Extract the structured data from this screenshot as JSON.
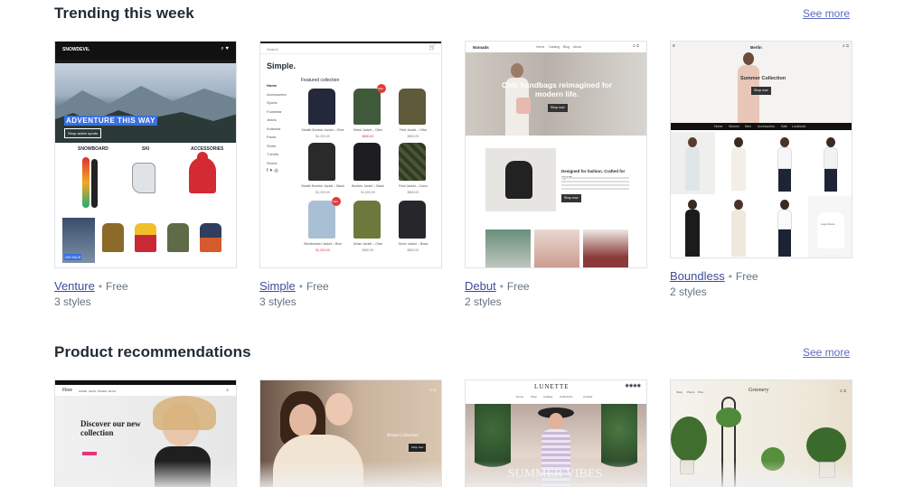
{
  "sections": [
    {
      "title": "Trending this week",
      "see_more": "See more",
      "themes": [
        {
          "name": "Venture",
          "price": "Free",
          "styles": "3 styles",
          "preview": {
            "logo": "SNOWDEVIL",
            "hero": "ADVENTURE THIS WAY",
            "hero_cta": "Shop action sports",
            "cats": [
              "SNOWBOARD",
              "SKI",
              "ACCESSORIES"
            ],
            "badge": "ON SALE"
          }
        },
        {
          "name": "Simple",
          "price": "Free",
          "styles": "3 styles",
          "preview": {
            "logo": "Simple.",
            "heading": "Featured collection",
            "search": "Search",
            "nav": [
              "Home",
              "Accessories",
              "Sports",
              "Footwear",
              "Jeans",
              "Knitwear",
              "Pants",
              "Shirts",
              "T-shirts",
              "Shorts"
            ],
            "products": [
              "Stealth Bomber Jacket – Olive",
              "Rebel Jacket – Olive",
              "Field Jacket – Olive",
              "Stealth Bomber Jacket – Black",
              "Bomber Jacket – Black",
              "Field Jacket – Camo",
              "Windbreaker Jacket – Blue",
              "Urban Jacket – Olive",
              "Storm Jacket – Black"
            ],
            "prices": [
              "$1,200.00",
              "$800.00",
              "$800.00",
              "$1,200.00",
              "$1,000.00",
              "$800.00",
              "$1,200.00",
              "$800.00",
              "$800.00"
            ],
            "sale": "Sale"
          }
        },
        {
          "name": "Debut",
          "price": "Free",
          "styles": "2 styles",
          "preview": {
            "logo": "Nomads",
            "nav": [
              "Home",
              "Catalog",
              "Blog",
              "About"
            ],
            "hero": "Chic handbags reimagined for modern life.",
            "hero_cta": "Shop now",
            "feature": "Designed for fashion. Crafted for sport.",
            "feature_cta": "Shop now"
          }
        },
        {
          "name": "Boundless",
          "price": "Free",
          "styles": "2 styles",
          "preview": {
            "logo": "Berlin",
            "hero": "Summer Collection",
            "hero_cta": "Shop now",
            "nav": [
              "Home",
              "Women",
              "Men",
              "Accessories",
              "Sale",
              "Lookbook"
            ],
            "tile_label": "Logo Dress"
          }
        }
      ]
    },
    {
      "title": "Product recommendations",
      "see_more": "See more",
      "themes": [
        {
          "preview": {
            "logo": "Flow",
            "nav": [
              "HOME",
              "SHOP",
              "PAGES",
              "BLOG"
            ],
            "hero": "Discover our new collection"
          }
        },
        {
          "preview": {
            "hero": "Bridal Collection",
            "cta": "Shop now"
          }
        },
        {
          "preview": {
            "logo": "LUNETTE",
            "tagline": "SUMMER VIBES",
            "nav": [
              "Home",
              "Shop",
              "Catalog",
              "Collections",
              "Contact"
            ]
          }
        },
        {
          "preview": {
            "logo": "Greenery",
            "nav": [
              "Shop",
              "Plants",
              "Pots"
            ]
          }
        }
      ]
    }
  ]
}
